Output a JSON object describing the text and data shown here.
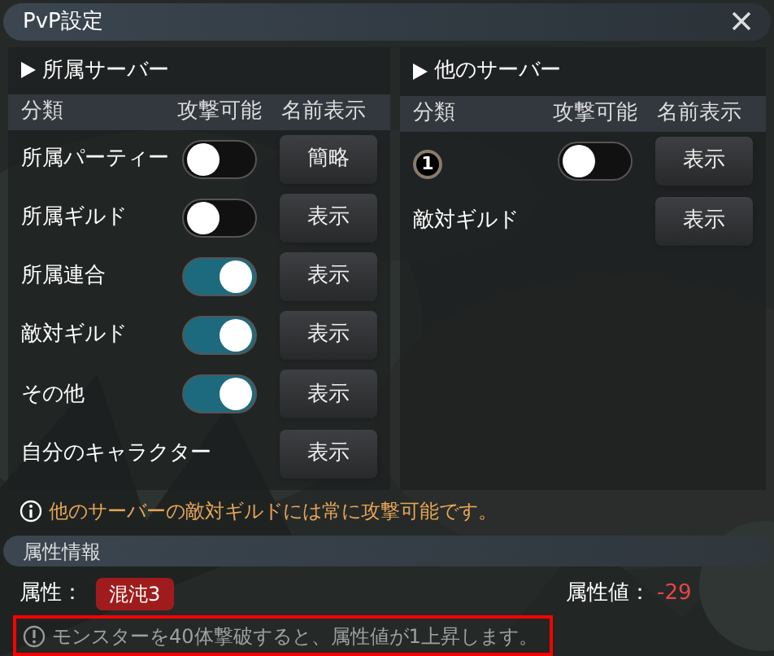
{
  "window": {
    "title": "PvP設定"
  },
  "panels": [
    {
      "heading": "所属サーバー",
      "columns": [
        "分類",
        "攻撃可能",
        "名前表示"
      ],
      "rows": [
        {
          "kind": "toggle",
          "label": "所属パーティー",
          "on": false,
          "button": "簡略"
        },
        {
          "kind": "toggle",
          "label": "所属ギルド",
          "on": false,
          "button": "表示"
        },
        {
          "kind": "toggle",
          "label": "所属連合",
          "on": true,
          "button": "表示"
        },
        {
          "kind": "toggle",
          "label": "敵対ギルド",
          "on": true,
          "button": "表示"
        },
        {
          "kind": "toggle",
          "label": "その他",
          "on": true,
          "button": "表示"
        },
        {
          "kind": "plain",
          "label": "自分のキャラクター",
          "button": "表示"
        }
      ]
    },
    {
      "heading": "他のサーバー",
      "columns": [
        "分類",
        "攻撃可能",
        "名前表示"
      ],
      "rows": [
        {
          "kind": "badge",
          "badge": "1",
          "on": false,
          "button": "表示"
        },
        {
          "kind": "plain",
          "label": "敵対ギルド",
          "button": "表示"
        }
      ]
    }
  ],
  "notice": "他のサーバーの敵対ギルドには常に攻撃可能です。",
  "attribute_section": {
    "title": "属性情報",
    "attribute_label": "属性：",
    "attribute_tag": "混沌3",
    "value_label": "属性値：",
    "value": "-29",
    "hint": "モンスターを40体撃破すると、属性値が1上昇します。"
  }
}
